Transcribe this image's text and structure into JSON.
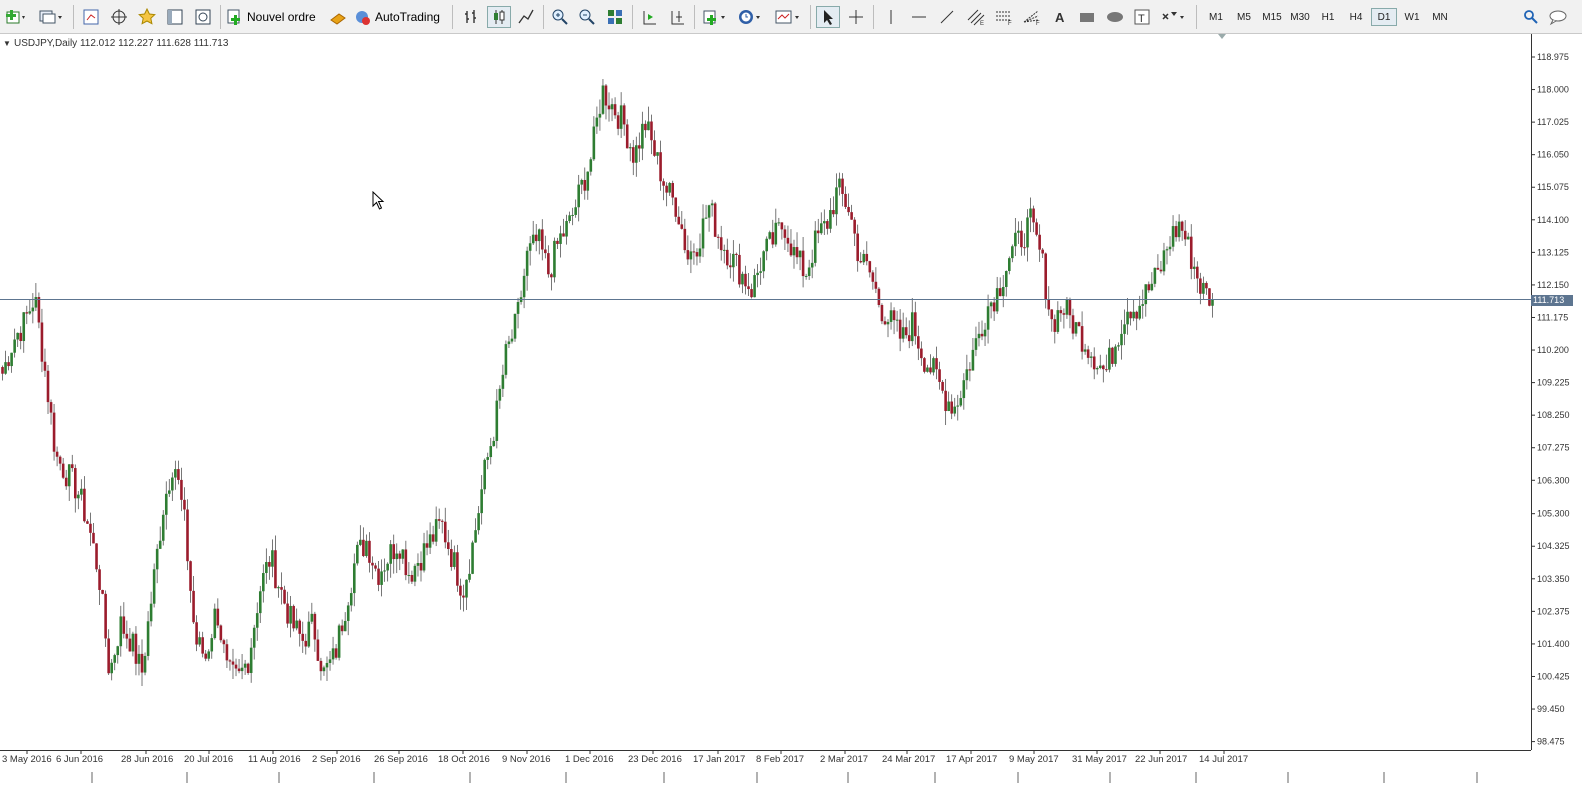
{
  "toolbar": {
    "new_order_label": "Nouvel ordre",
    "autotrading_label": "AutoTrading",
    "timeframes": [
      "M1",
      "M5",
      "M15",
      "M30",
      "H1",
      "H4",
      "D1",
      "W1",
      "MN"
    ],
    "active_timeframe": "D1",
    "icons": [
      "new-chart-icon",
      "profiles-icon",
      "market-watch-icon",
      "navigator-icon",
      "favorites-icon",
      "data-window-icon",
      "strategy-tester-icon",
      "new-order-icon",
      "experts-icon",
      "bar-chart-icon",
      "candlestick-icon",
      "line-chart-icon",
      "zoom-in-icon",
      "zoom-out-icon",
      "tile-windows-icon",
      "autoscroll-icon",
      "chart-shift-icon",
      "indicators-icon",
      "periods-icon",
      "templates-icon",
      "cursor-icon",
      "crosshair-icon",
      "vertical-line-icon",
      "horizontal-line-icon",
      "trendline-icon",
      "equidistant-channel-icon",
      "fibonacci-retracement-icon",
      "fibonacci-fan-icon",
      "text-icon",
      "rectangle-icon",
      "ellipse-icon",
      "text-label-icon",
      "arrows-icon",
      "search-icon",
      "chat-icon"
    ]
  },
  "chart": {
    "symbol_info": "USDJPY,Daily  112.012 112.227 111.628 111.713",
    "current_price": "111.713",
    "bull_color": "#2e7d32",
    "bear_color": "#9b1c2c",
    "axis_color": "#333333",
    "price_line_color": "#5d7590"
  },
  "chart_data": {
    "type": "candlestick",
    "symbol": "USDJPY",
    "timeframe": "Daily",
    "y_ticks": [
      "118.975",
      "118.000",
      "117.025",
      "116.050",
      "115.075",
      "114.100",
      "113.125",
      "112.150",
      "111.175",
      "110.200",
      "109.225",
      "108.250",
      "107.275",
      "106.300",
      "105.300",
      "104.325",
      "103.350",
      "102.375",
      "101.400",
      "100.425",
      "99.450",
      "98.475"
    ],
    "x_ticks": [
      "3 May 2016",
      "6 Jun 2016",
      "28 Jun 2016",
      "20 Jul 2016",
      "11 Aug 2016",
      "2 Sep 2016",
      "26 Sep 2016",
      "18 Oct 2016",
      "9 Nov 2016",
      "1 Dec 2016",
      "23 Dec 2016",
      "17 Jan 2017",
      "8 Feb 2017",
      "2 Mar 2017",
      "24 Mar 2017",
      "17 Apr 2017",
      "9 May 2017",
      "31 May 2017",
      "22 Jun 2017",
      "14 Jul 2017"
    ],
    "ylim": [
      98.0,
      120.0
    ],
    "last_close": 111.713,
    "close_path": [
      109.5,
      110.5,
      111.0,
      111.8,
      109.5,
      107.0,
      106.5,
      106.0,
      105.0,
      103.5,
      100.5,
      102.0,
      101.5,
      100.5,
      103.0,
      105.5,
      107.0,
      105.0,
      101.5,
      101.0,
      102.5,
      100.5,
      100.3,
      101.0,
      103.0,
      104.0,
      103.0,
      102.0,
      101.5,
      102.0,
      100.5,
      101.0,
      102.5,
      104.0,
      104.5,
      103.5,
      104.0,
      104.5,
      103.5,
      104.0,
      104.5,
      105.0,
      104.0,
      103.0,
      104.5,
      106.5,
      108.0,
      110.0,
      111.0,
      113.0,
      113.5,
      112.5,
      113.5,
      114.0,
      115.0,
      116.0,
      118.0,
      117.5,
      117.0,
      116.0,
      117.0,
      116.0,
      115.0,
      114.5,
      113.0,
      113.5,
      114.5,
      113.5,
      113.0,
      112.5,
      112.0,
      113.0,
      113.5,
      114.0,
      113.0,
      112.5,
      113.5,
      114.0,
      115.0,
      114.5,
      113.0,
      112.5,
      111.5,
      111.0,
      110.5,
      111.0,
      110.0,
      109.5,
      108.8,
      108.5,
      109.5,
      110.5,
      111.5,
      112.0,
      113.0,
      113.5,
      114.0,
      113.0,
      111.0,
      111.5,
      111.0,
      110.5,
      110.0,
      109.5,
      110.5,
      111.5,
      111.5,
      112.0,
      112.5,
      113.5,
      114.0,
      113.0,
      112.0,
      111.713
    ]
  }
}
